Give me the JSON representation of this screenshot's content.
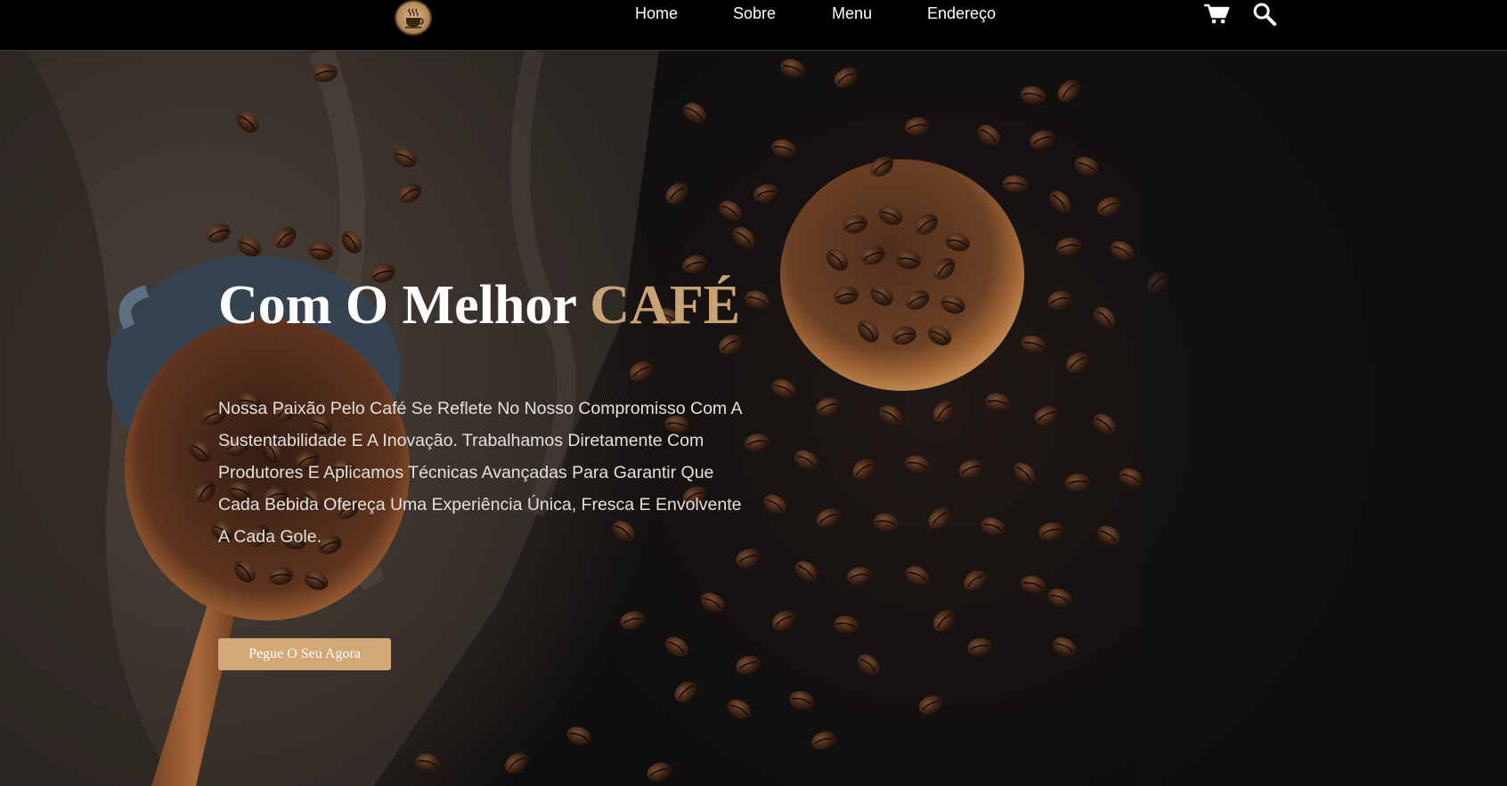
{
  "header": {
    "logo_icon": "coffee-cup-icon",
    "nav": [
      {
        "label": "Home"
      },
      {
        "label": "Sobre"
      },
      {
        "label": "Menu"
      },
      {
        "label": "Endereço"
      }
    ],
    "cart_icon": "cart-icon",
    "search_icon": "search-icon"
  },
  "hero": {
    "title_prefix": "Com O Melhor",
    "title_accent": "CAFÉ",
    "description": "Nossa Paixão Pelo Café Se Reflete No Nosso Compromisso Com A Sustentabilidade E A Inovação. Trabalhamos Diretamente Com Produtores E Aplicamos Técnicas Avançadas Para Garantir Que Cada Bebida Ofereça Uma Experiência Única, Fresca E Envolvente A Cada Gole.",
    "cta_label": "Pegue O Seu Agora",
    "background_image": "coffee beans with wooden scoops on burlap sack"
  },
  "colors": {
    "header_bg": "#000000",
    "accent": "#c9a273",
    "button_bg": "#d1a876",
    "text": "#ffffff"
  }
}
